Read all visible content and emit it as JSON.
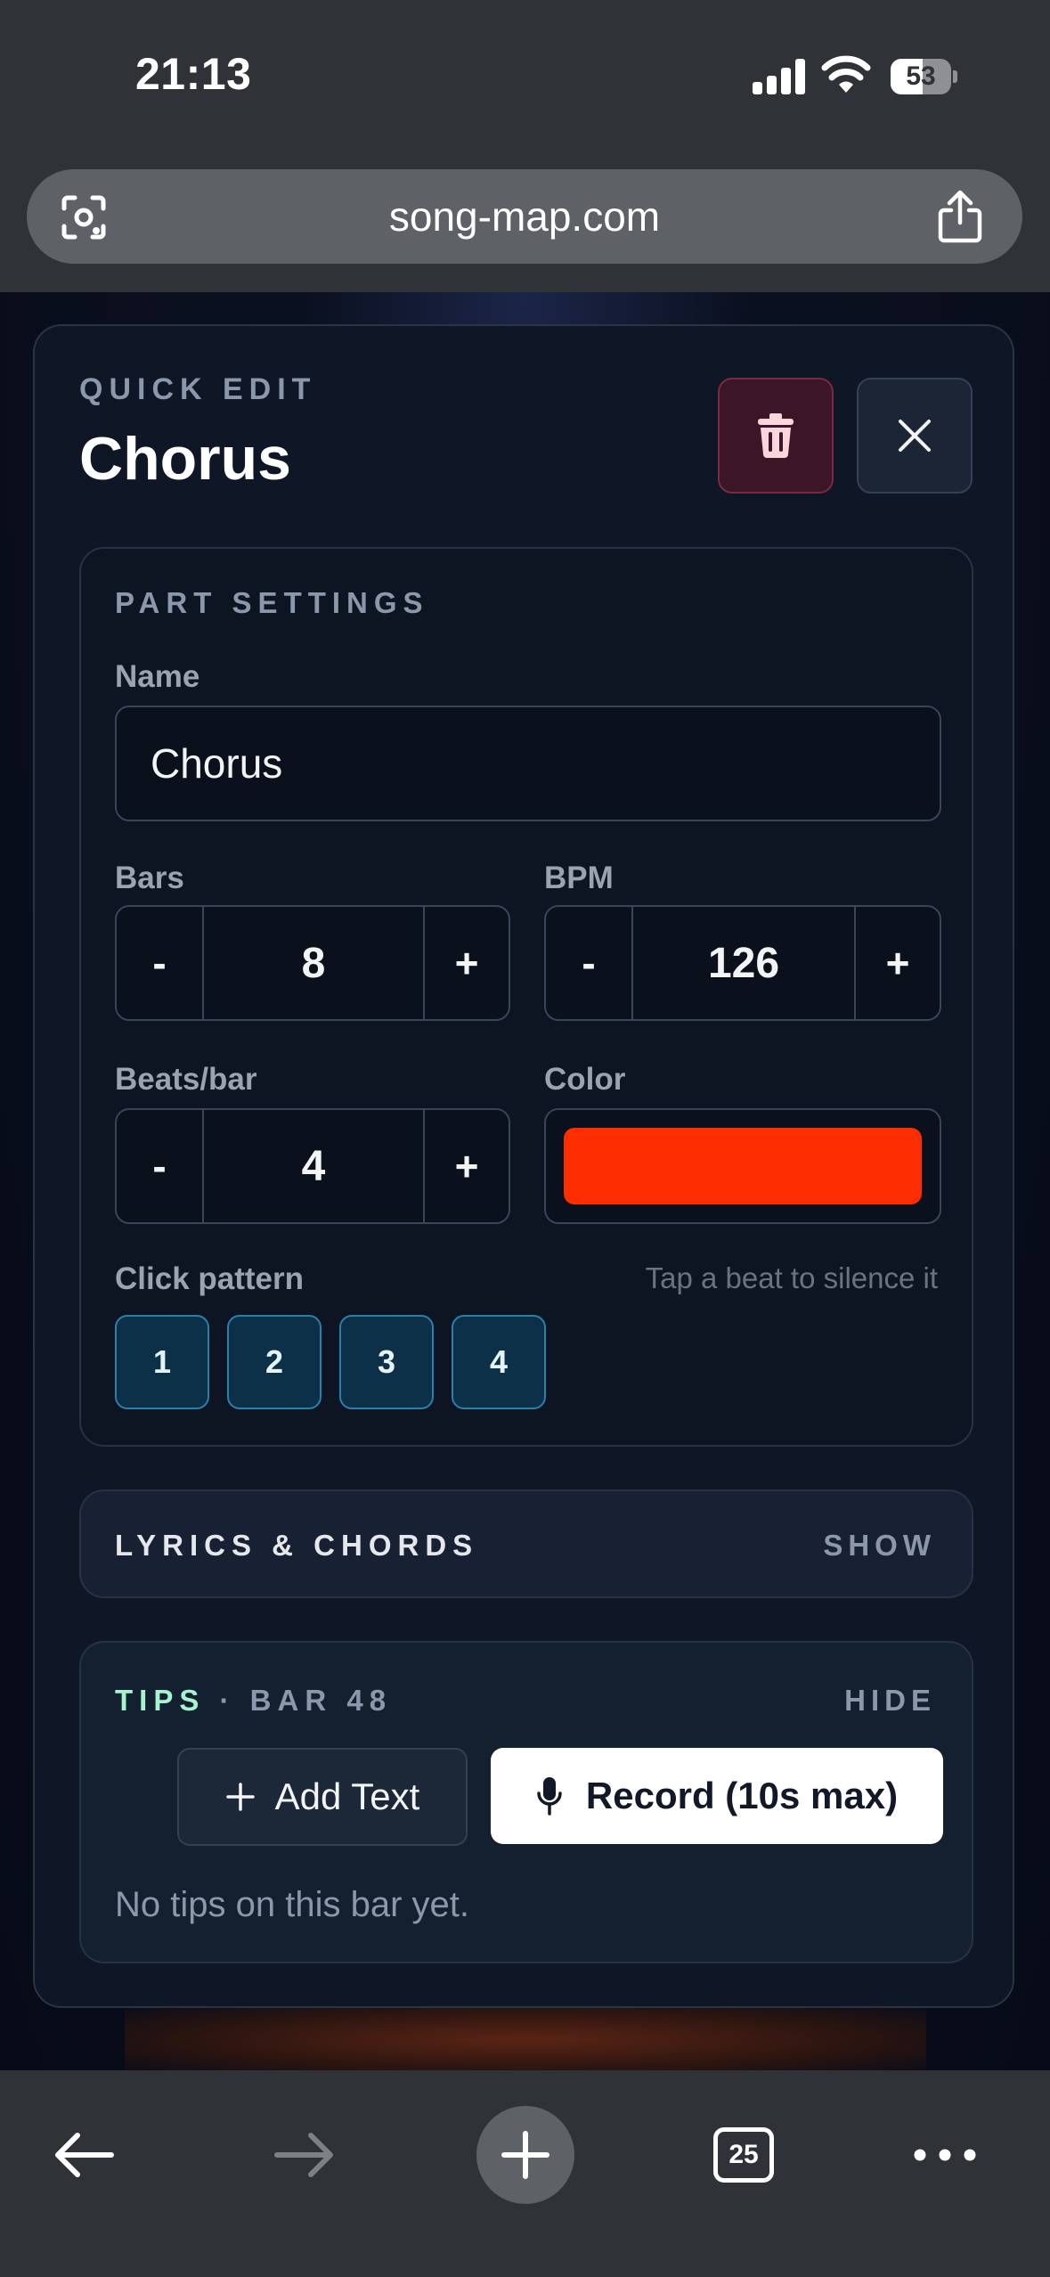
{
  "status_bar": {
    "time": "21:13",
    "battery": "53",
    "battery_level": 0.53
  },
  "browser": {
    "url": "song-map.com",
    "tab_count": "25"
  },
  "modal": {
    "eyebrow": "QUICK EDIT",
    "title": "Chorus"
  },
  "part_settings": {
    "section_title": "PART SETTINGS",
    "name_label": "Name",
    "name_value": "Chorus",
    "bars_label": "Bars",
    "bars_value": "8",
    "bpm_label": "BPM",
    "bpm_value": "126",
    "beats_label": "Beats/bar",
    "beats_value": "4",
    "color_label": "Color",
    "color_value": "#ff2e00",
    "minus_label": "-",
    "plus_label": "+",
    "click_label": "Click pattern",
    "click_hint": "Tap a beat to silence it",
    "beats": [
      "1",
      "2",
      "3",
      "4"
    ]
  },
  "lyrics": {
    "title": "LYRICS & CHORDS",
    "toggle": "SHOW"
  },
  "tips": {
    "title_a": "TIPS",
    "title_b": " · BAR 48",
    "toggle": "HIDE",
    "add_text_label": "Add Text",
    "record_label": "Record (10s max)",
    "empty_text": "No tips on this bar yet."
  },
  "colors": {
    "accent_beat": "#0c3048",
    "danger_bg": "#3c1527",
    "tips_accent": "#a7f3d0"
  },
  "icons": [
    "lens-icon",
    "share-icon",
    "trash-icon",
    "close-icon",
    "plus-icon",
    "mic-icon",
    "back-icon",
    "forward-icon",
    "new-tab-icon",
    "tabs-icon",
    "more-icon"
  ]
}
